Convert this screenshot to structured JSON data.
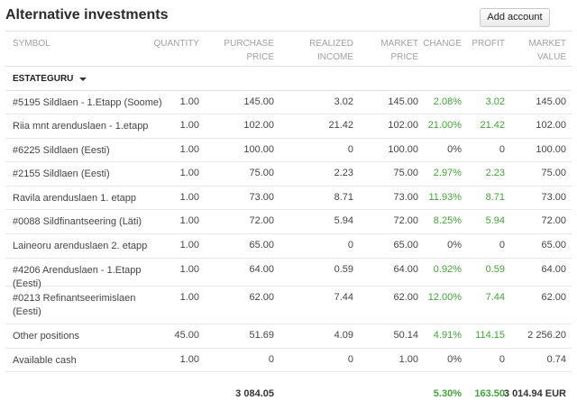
{
  "page": {
    "title": "Alternative investments",
    "add_button": "Add account"
  },
  "columns": [
    "SYMBOL",
    "QUANTITY",
    "PURCHASE\nPRICE",
    "REALIZED\nINCOME",
    "MARKET\nPRICE",
    "CHANGE",
    "PROFIT",
    "MARKET\nVALUE"
  ],
  "group": {
    "label": "ESTATEGURU"
  },
  "rows": [
    {
      "symbol": "#5195 Sildlaen - 1.Etapp (Soome)",
      "quantity": "1.00",
      "purchase_price": "145.00",
      "realized_income": "3.02",
      "market_price": "145.00",
      "change": "2.08%",
      "profit": "3.02",
      "market_value": "145.00",
      "positive": true
    },
    {
      "symbol": "Riia mnt arenduslaen - 1.etapp",
      "quantity": "1.00",
      "purchase_price": "102.00",
      "realized_income": "21.42",
      "market_price": "102.00",
      "change": "21.00%",
      "profit": "21.42",
      "market_value": "102.00",
      "positive": true
    },
    {
      "symbol": "#6225 Sildlaen (Eesti)",
      "quantity": "1.00",
      "purchase_price": "100.00",
      "realized_income": "0",
      "market_price": "100.00",
      "change": "0%",
      "profit": "0",
      "market_value": "100.00",
      "positive": false
    },
    {
      "symbol": "#2155 Sildlaen (Eesti)",
      "quantity": "1.00",
      "purchase_price": "75.00",
      "realized_income": "2.23",
      "market_price": "75.00",
      "change": "2.97%",
      "profit": "2.23",
      "market_value": "75.00",
      "positive": true
    },
    {
      "symbol": "Ravila arenduslaen 1. etapp",
      "quantity": "1.00",
      "purchase_price": "73.00",
      "realized_income": "8.71",
      "market_price": "73.00",
      "change": "11.93%",
      "profit": "8.71",
      "market_value": "73.00",
      "positive": true
    },
    {
      "symbol": "#0088 Sildfinantseering (Läti)",
      "quantity": "1.00",
      "purchase_price": "72.00",
      "realized_income": "5.94",
      "market_price": "72.00",
      "change": "8.25%",
      "profit": "5.94",
      "market_value": "72.00",
      "positive": true
    },
    {
      "symbol": "Laineoru arenduslaen 2. etapp",
      "quantity": "1.00",
      "purchase_price": "65.00",
      "realized_income": "0",
      "market_price": "65.00",
      "change": "0%",
      "profit": "0",
      "market_value": "65.00",
      "positive": false
    },
    {
      "symbol": "#4206 Arenduslaen - 1.Etapp\n(Eesti)",
      "quantity": "1.00",
      "purchase_price": "64.00",
      "realized_income": "0.59",
      "market_price": "64.00",
      "change": "0.92%",
      "profit": "0.59",
      "market_value": "64.00",
      "positive": true
    },
    {
      "symbol": "#0213 Refinantseerimislaen\n(Eesti)",
      "quantity": "1.00",
      "purchase_price": "62.00",
      "realized_income": "7.44",
      "market_price": "62.00",
      "change": "12.00%",
      "profit": "7.44",
      "market_value": "62.00",
      "positive": true
    },
    {
      "symbol": "Other positions",
      "quantity": "45.00",
      "purchase_price": "51.69",
      "realized_income": "4.09",
      "market_price": "50.14",
      "change": "4.91%",
      "profit": "114.15",
      "market_value": "2 256.20",
      "positive": true
    },
    {
      "symbol": "Available cash",
      "quantity": "1.00",
      "purchase_price": "0",
      "realized_income": "0",
      "market_price": "1.00",
      "change": "0%",
      "profit": "0",
      "market_value": "0.74",
      "positive": false
    }
  ],
  "total": {
    "purchase_price": "3 084.05",
    "change": "5.30%",
    "profit": "163.50",
    "market_value": "3 014.94 EUR"
  },
  "colors": {
    "positive": "#3fa535",
    "header_text": "#a0a0a0",
    "border": "#e2e2e2"
  }
}
